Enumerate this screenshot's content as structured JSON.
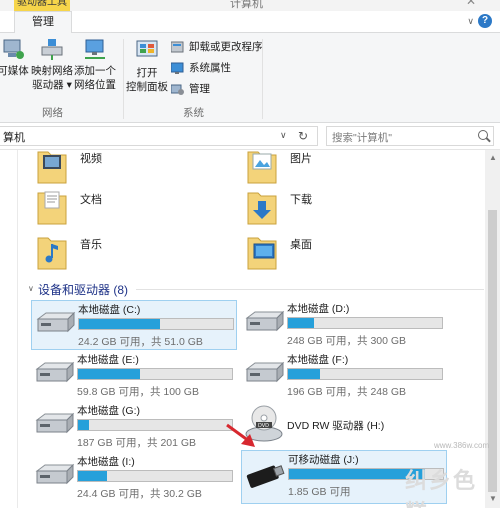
{
  "window": {
    "drive_tools_tab": "驱动器工具",
    "title": "计算机",
    "close_glyph": "✕"
  },
  "ribbon_tabs": {
    "manage": "管理",
    "collapse_glyph": "∨",
    "help_glyph": "?"
  },
  "ribbon": {
    "media_label": "可媒体",
    "map_drive_l1": "映射网络",
    "map_drive_l2": "驱动器",
    "add_location_l1": "添加一个",
    "add_location_l2": "网络位置",
    "network_group": "网络",
    "open_cp_l1": "打开",
    "open_cp_l2": "控制面板",
    "uninstall": "卸载或更改程序",
    "sysprops": "系统属性",
    "manage": "管理",
    "system_group": "系统",
    "dropdown_glyph": "▾"
  },
  "address": {
    "path": "算机",
    "dd_glyph": "∨",
    "refresh_glyph": "↻"
  },
  "search": {
    "placeholder": "搜索\"计算机\""
  },
  "scroll": {
    "up": "▲",
    "down": "▼"
  },
  "folders": [
    {
      "label": "视频",
      "icon": "video-folder-icon"
    },
    {
      "label": "图片",
      "icon": "pictures-folder-icon"
    },
    {
      "label": "文档",
      "icon": "documents-folder-icon"
    },
    {
      "label": "下载",
      "icon": "downloads-folder-icon"
    },
    {
      "label": "音乐",
      "icon": "music-folder-icon"
    },
    {
      "label": "桌面",
      "icon": "desktop-folder-icon"
    }
  ],
  "section": {
    "title": "设备和驱动器 (8)",
    "chevron": "∨"
  },
  "drives": [
    {
      "name": "本地磁盘 (C:)",
      "info": "24.2 GB 可用，共 51.0 GB",
      "used": 0.525
    },
    {
      "name": "本地磁盘 (D:)",
      "info": "248 GB 可用，共 300 GB",
      "used": 0.17
    },
    {
      "name": "本地磁盘 (E:)",
      "info": "59.8 GB 可用，共 100 GB",
      "used": 0.4
    },
    {
      "name": "本地磁盘 (F:)",
      "info": "196 GB 可用，共 248 GB",
      "used": 0.21
    },
    {
      "name": "本地磁盘 (G:)",
      "info": "187 GB 可用，共 201 GB",
      "used": 0.07
    },
    {
      "name": "DVD RW 驱动器 (H:)",
      "info": "",
      "used": null
    },
    {
      "name": "本地磁盘 (I:)",
      "info": "24.4 GB 可用，共 30.2 GB",
      "used": 0.19
    },
    {
      "name": "可移动磁盘 (J:)",
      "info": "1.85 GB 可用",
      "used": 0.88
    }
  ],
  "watermark": {
    "logo": "纠乡色糕",
    "site": "www.386w.com"
  },
  "colors": {
    "accent": "#26a0da",
    "section": "#1e3287",
    "selection": "#e6f2fb"
  }
}
